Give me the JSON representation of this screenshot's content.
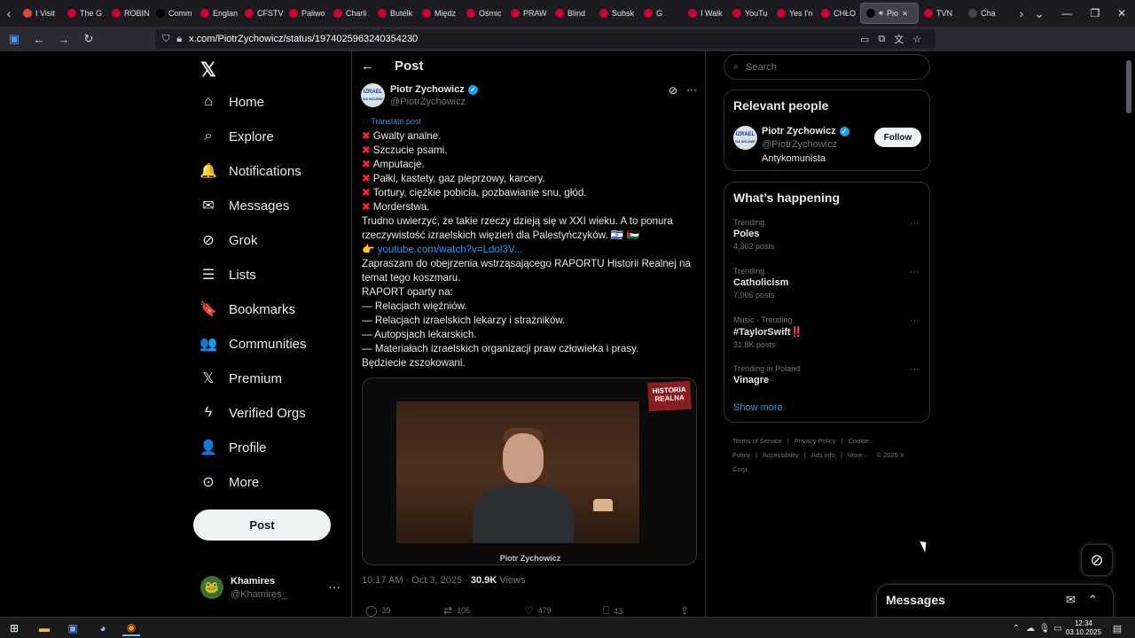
{
  "browser": {
    "tabs": [
      {
        "label": "I Visit",
        "fav_color": "#e04a3a"
      },
      {
        "label": "The G",
        "fav_color": "#cc0033"
      },
      {
        "label": "ROBIN",
        "fav_color": "#cc0033"
      },
      {
        "label": "Comm",
        "fav_color": "#000000"
      },
      {
        "label": "Englan",
        "fav_color": "#cc0033"
      },
      {
        "label": "CFSTV",
        "fav_color": "#cc0033"
      },
      {
        "label": "Paliwo",
        "fav_color": "#cc0033"
      },
      {
        "label": "Charli",
        "fav_color": "#cc0033"
      },
      {
        "label": "Butelk",
        "fav_color": "#cc0033"
      },
      {
        "label": "Międz",
        "fav_color": "#cc0033"
      },
      {
        "label": "Ośmic",
        "fav_color": "#cc0033"
      },
      {
        "label": "PRAW",
        "fav_color": "#cc0033"
      },
      {
        "label": "Blind",
        "fav_color": "#cc0033"
      },
      {
        "label": "Subsk",
        "fav_color": "#cc0033"
      },
      {
        "label": "G",
        "fav_color": "#cc0033"
      },
      {
        "label": "I Walk",
        "fav_color": "#cc0033"
      },
      {
        "label": "YouTu",
        "fav_color": "#cc0033"
      },
      {
        "label": "Yes I'n",
        "fav_color": "#cc0033"
      },
      {
        "label": "CHŁO",
        "fav_color": "#cc0033"
      },
      {
        "label": "Pio",
        "fav_color": "#000000",
        "active": true
      },
      {
        "label": "TVN",
        "fav_color": "#cc0033"
      },
      {
        "label": "Cha",
        "fav_color": "#444444"
      }
    ],
    "url": "x.com/PiotrZychowicz/status/1974025963240354230"
  },
  "nav": {
    "items": [
      {
        "label": "Home",
        "icon": "home-icon",
        "glyph": "⌂"
      },
      {
        "label": "Explore",
        "icon": "search-icon",
        "glyph": "⌕"
      },
      {
        "label": "Notifications",
        "icon": "bell-icon",
        "glyph": "🔔"
      },
      {
        "label": "Messages",
        "icon": "envelope-icon",
        "glyph": "✉"
      },
      {
        "label": "Grok",
        "icon": "grok-icon",
        "glyph": "⊘"
      },
      {
        "label": "Lists",
        "icon": "list-icon",
        "glyph": "☰"
      },
      {
        "label": "Bookmarks",
        "icon": "bookmark-icon",
        "glyph": "🔖"
      },
      {
        "label": "Communities",
        "icon": "communities-icon",
        "glyph": "👥"
      },
      {
        "label": "Premium",
        "icon": "x-premium-icon",
        "glyph": "𝕏"
      },
      {
        "label": "Verified Orgs",
        "icon": "lightning-icon",
        "glyph": "ϟ"
      },
      {
        "label": "Profile",
        "icon": "person-icon",
        "glyph": "👤"
      },
      {
        "label": "More",
        "icon": "more-circle-icon",
        "glyph": "⊙"
      }
    ],
    "post_label": "Post",
    "account": {
      "name": "Khamires",
      "handle": "@Khamires_"
    }
  },
  "post": {
    "header_title": "Post",
    "author_name": "Piotr Zychowicz",
    "author_handle": "@PiotrZychowicz",
    "avatar_text_1": "IZRAEL",
    "avatar_text_2": "NA WOJNIE",
    "translate_label": "Translate post",
    "body_lines": [
      {
        "text": "Gwalty analne.",
        "mark": true
      },
      {
        "text": "Szczucie psami.",
        "mark": true
      },
      {
        "text": "Amputacje.",
        "mark": true
      },
      {
        "text": "Pałki, kastety, gaz pieprzowy, karcery.",
        "mark": true
      },
      {
        "text": "Tortury, ciężkie pobicia, pozbawianie snu, głód.",
        "mark": true
      },
      {
        "text": "Morderstwa.",
        "mark": true
      },
      {
        "text": "Trudno uwierzyć, że takie rzeczy dzieją się w XXI wieku. A to ponura"
      },
      {
        "text": "rzeczywistość izraelskich więzień dla Palestyńczyków. 🇮🇱 🇵🇸"
      },
      {
        "text": "youtube.com/watch?v=Ldol3V...",
        "link": true,
        "prefix": "👉 "
      },
      {
        "text": "Zapraszam do obejrzenia wstrząsającego RAPORTU Historii Realnej na"
      },
      {
        "text": "temat tego koszmaru."
      },
      {
        "text": "RAPORT oparty na:"
      },
      {
        "text": "— Relacjach więźniów."
      },
      {
        "text": "— Relacjach izraelskich lekarzy i strażników."
      },
      {
        "text": "— Autopsjach lekarskich."
      },
      {
        "text": "— Materiałach izraelskich organizacji praw człowieka i prasy."
      },
      {
        "text": "Będziecie zszokowani."
      }
    ],
    "video_logo_1": "HISTORIA",
    "video_logo_2": "REALNA",
    "video_caption": "Piotr Zychowicz",
    "time": "10:17 AM · Oct 3, 2025 · ",
    "views_count": "30.9K",
    "views_label": " Views",
    "actions": [
      {
        "icon": "reply-icon",
        "glyph": "◯",
        "count": "39"
      },
      {
        "icon": "retweet-icon",
        "glyph": "⇄",
        "count": "105"
      },
      {
        "icon": "like-icon",
        "glyph": "♡",
        "count": "479"
      },
      {
        "icon": "bookmark-icon",
        "glyph": "⎕",
        "count": "43"
      },
      {
        "icon": "share-icon",
        "glyph": "⇪",
        "count": ""
      }
    ]
  },
  "sidebar": {
    "search_placeholder": "Search",
    "relevant_title": "Relevant people",
    "relevant_person": {
      "name": "Piotr Zychowicz",
      "handle": "@PiotrZychowicz",
      "bio": "Antykomunista",
      "follow_label": "Follow"
    },
    "happening_title": "What’s happening",
    "trends": [
      {
        "context": "Trending",
        "name": "Poles",
        "count": "4,302 posts"
      },
      {
        "context": "Trending",
        "name": "Catholicism",
        "count": "7,006 posts"
      },
      {
        "context": "Music · Trending",
        "name": "#TaylorSwift‼️",
        "count": "31.8K posts"
      },
      {
        "context": "Trending in Poland",
        "name": "Vinagre",
        "count": ""
      }
    ],
    "show_more": "Show more",
    "footer": [
      "Terms of Service",
      "|",
      "Privacy Policy",
      "|",
      "Cookie Policy",
      "|",
      "Accessibility",
      "|",
      "Ads info",
      "|",
      "More ···",
      "© 2025 X Corp."
    ]
  },
  "messages_drawer": {
    "title": "Messages"
  },
  "taskbar": {
    "time": "12:34",
    "date": "03.10.2025"
  }
}
